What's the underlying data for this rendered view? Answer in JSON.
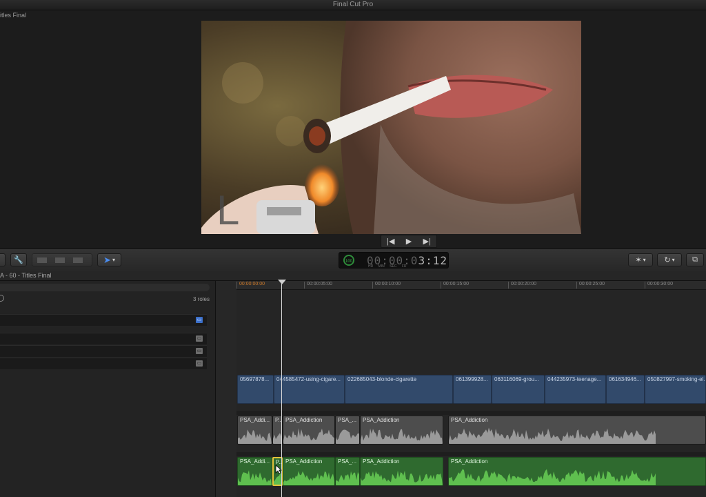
{
  "app": {
    "title": "Final Cut Pro"
  },
  "viewer": {
    "title": "itles Final",
    "transport": {
      "prev": "|◀",
      "play": "▶",
      "next": "▶|"
    }
  },
  "toolbar": {
    "timecode": {
      "dim": "00:00:0",
      "value": "3:12",
      "percent": "100",
      "units": "HR MIN SEC FR"
    },
    "select_tool": "▾"
  },
  "project": {
    "name": "A - 60 - Titles Final"
  },
  "index": {
    "roles_label": "3 roles"
  },
  "ruler": {
    "ticks": [
      "00:00:00:00",
      "00:00:05:00",
      "00:00:10:00",
      "00:00:15:00",
      "00:00:20:00",
      "00:00:25:00",
      "00:00:30:00"
    ]
  },
  "video_clips": [
    "05697878...",
    "044585472-using-cigare...",
    "022685043-blonde-cigarette",
    "061399928...",
    "063116069-grou...",
    "044235973-teenage...",
    "061634946...",
    "050827997-smoking-el..."
  ],
  "audio_clips": [
    "PSA_Addi...",
    "P...",
    "PSA_Addiction",
    "PSA_...",
    "PSA_Addiction",
    "PSA_Addiction"
  ],
  "green_clips": [
    "PSA_Addi...",
    "P...",
    "PSA_Addiction",
    "PSA_...",
    "PSA_Addiction",
    "PSA_Addiction"
  ],
  "colors": {
    "video_clip": "#324a6b",
    "audio_clip": "#4d4d4d",
    "green_clip": "#2f6a2f",
    "selection": "#e3c43a",
    "start_tick": "#d07b2a"
  }
}
